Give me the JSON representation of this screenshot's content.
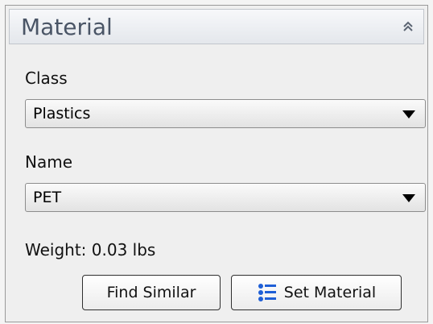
{
  "panel": {
    "title": "Material",
    "collapse_icon": "double-chevron-up-icon"
  },
  "class_field": {
    "label": "Class",
    "value": "Plastics"
  },
  "name_field": {
    "label": "Name",
    "value": "PET"
  },
  "weight": {
    "text": "Weight:  0.03 lbs"
  },
  "buttons": {
    "find_similar": "Find Similar",
    "set_material": "Set Material",
    "set_material_icon": "material-list-icon"
  },
  "colors": {
    "title_text": "#4a5566",
    "icon_blue": "#1f5fd6"
  }
}
